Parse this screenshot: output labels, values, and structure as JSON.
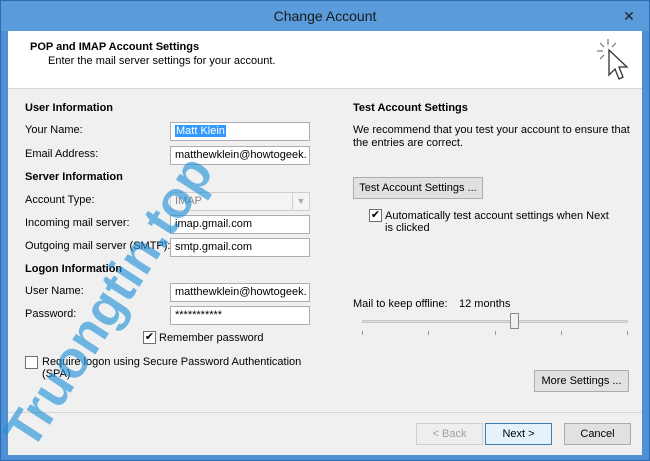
{
  "window": {
    "title": "Change Account",
    "close_glyph": "✕"
  },
  "header": {
    "title": "POP and IMAP Account Settings",
    "subtitle": "Enter the mail server settings for your account."
  },
  "user_info": {
    "heading": "User Information",
    "name_label": "Your Name:",
    "name_value": "Matt Klein",
    "email_label": "Email Address:",
    "email_value": "matthewklein@howtogeek."
  },
  "server_info": {
    "heading": "Server Information",
    "account_type_label": "Account Type:",
    "account_type_value": "IMAP",
    "incoming_label": "Incoming mail server:",
    "incoming_value": "imap.gmail.com",
    "outgoing_label": "Outgoing mail server (SMTP):",
    "outgoing_value": "smtp.gmail.com"
  },
  "logon_info": {
    "heading": "Logon Information",
    "username_label": "User Name:",
    "username_value": "matthewklein@howtogeek.",
    "password_label": "Password:",
    "password_value": "***********",
    "remember_label": "Remember password",
    "remember_checked": true,
    "spa_label_1": "Require logon using Secure Password Authentication",
    "spa_label_2": "(SPA)",
    "spa_checked": false
  },
  "test_settings": {
    "heading": "Test Account Settings",
    "desc_1": "We recommend that you test your account to ensure that",
    "desc_2": "the entries are correct.",
    "test_button": "Test Account Settings ...",
    "auto_label_1": "Automatically test account settings when Next",
    "auto_label_2": "is clicked",
    "auto_checked": true,
    "offline_label": "Mail to keep offline:",
    "offline_value": "12 months",
    "more_button": "More Settings ..."
  },
  "footer": {
    "back": "< Back",
    "next": "Next >",
    "cancel": "Cancel"
  },
  "watermark": "Truongtin.top",
  "colors": {
    "titlebar": "#5a9bdc",
    "selection": "#3399ff",
    "watermark": "#1e8fd6"
  }
}
